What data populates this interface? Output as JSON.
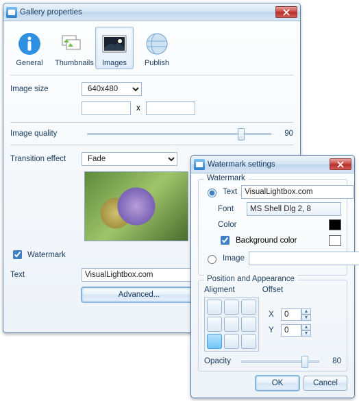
{
  "gallery": {
    "title": "Gallery properties",
    "tabs": {
      "general": "General",
      "thumbnails": "Thumbnails",
      "images": "Images",
      "publish": "Publish"
    },
    "imageSize": {
      "label": "Image size",
      "value": "640x480",
      "w": "",
      "h": "",
      "x": "x"
    },
    "quality": {
      "label": "Image quality",
      "value": "90"
    },
    "transition": {
      "label": "Transition effect",
      "value": "Fade"
    },
    "watermarkChk": "Watermark",
    "textLbl": "Text",
    "textVal": "VisualLightbox.com",
    "advanced": "Advanced..."
  },
  "ws": {
    "title": "Watermark settings",
    "group1": "Watermark",
    "textRadio": "Text",
    "textVal": "VisualLightbox.com",
    "fontLbl": "Font",
    "fontVal": "MS Shell Dlg 2, 8",
    "colorLbl": "Color",
    "colorVal": "#000000",
    "bgChk": "Background color",
    "bgColor": "#ffffff",
    "imageRadio": "Image",
    "imageVal": "",
    "browse": "...",
    "group2": "Position and Appearance",
    "alignLbl": "Aligment",
    "offsetLbl": "Offset",
    "xLbl": "X",
    "xVal": "0",
    "yLbl": "Y",
    "yVal": "0",
    "opacityLbl": "Opacity",
    "opacityVal": "80",
    "ok": "OK",
    "cancel": "Cancel"
  }
}
